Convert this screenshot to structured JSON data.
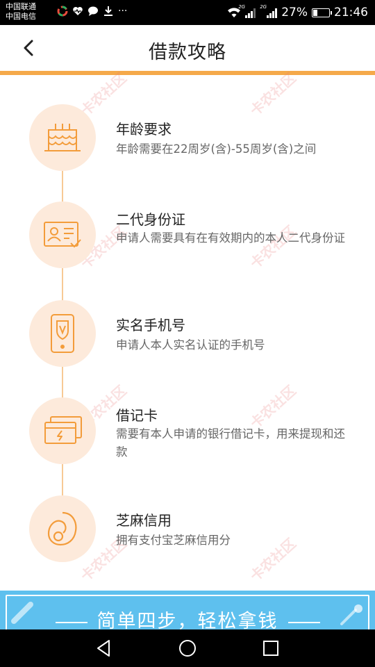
{
  "status_bar": {
    "carrier_1": "中国联通",
    "carrier_2": "中国电信",
    "signal_1_tag": "2G",
    "signal_2_tag": "2G",
    "battery_percent": "27%",
    "battery_level": 0.27,
    "time": "21:46",
    "more_icons": "···"
  },
  "header": {
    "title": "借款攻略"
  },
  "requirements": [
    {
      "title": "年龄要求",
      "desc": "年龄需要在22周岁(含)-55周岁(含)之间",
      "icon": "birthday-cake-icon"
    },
    {
      "title": "二代身份证",
      "desc": "申请人需要具有在有效期内的本人二代身份证",
      "icon": "id-card-icon"
    },
    {
      "title": "实名手机号",
      "desc": "申请人本人实名认证的手机号",
      "icon": "mobile-phone-icon"
    },
    {
      "title": "借记卡",
      "desc": "需要有本人申请的银行借记卡，用来提现和还款",
      "icon": "debit-card-icon"
    },
    {
      "title": "芝麻信用",
      "desc": "拥有支付宝芝麻信用分",
      "icon": "sesame-credit-icon"
    }
  ],
  "watermark": "卡农社区",
  "banner": {
    "text": "简单四步，轻松拿钱"
  },
  "colors": {
    "accent": "#f5a94a",
    "icon_bg": "#fdeadb",
    "banner": "#5ec0ee"
  }
}
